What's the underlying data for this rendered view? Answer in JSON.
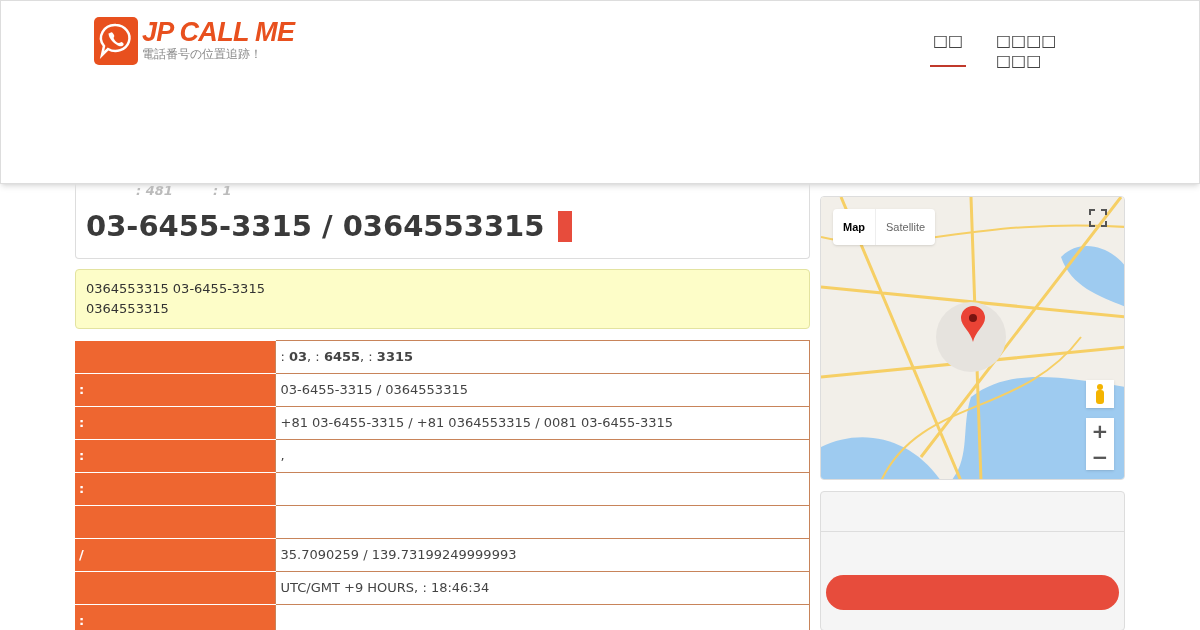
{
  "logo": {
    "title": "JP CALL ME",
    "tagline": "電話番号の位置追跡！"
  },
  "nav": [
    {
      "label": "□□",
      "selected": true
    },
    {
      "label": "□□□□ □□□",
      "selected": false
    }
  ],
  "stats": [
    ": 481",
    ": 1"
  ],
  "title": "03-6455-3315 / 0364553315",
  "notice": [
    "0364553315 03-6455-3315",
    "0364553315"
  ],
  "table": {
    "rows": [
      {
        "label": "",
        "value": ":  **03**, :  **6455**, :  **3315**"
      },
      {
        "label": ":",
        "value": "03-6455-3315 / 0364553315"
      },
      {
        "label": ":",
        "value": "+81 03-6455-3315 / +81 0364553315 / 0081 03-6455-3315"
      },
      {
        "label": ":",
        "value": ","
      },
      {
        "label": ":",
        "value": ""
      },
      {
        "label": "",
        "value": ""
      },
      {
        "label": "/",
        "value": "35.7090259 / 139.73199249999993"
      },
      {
        "label": "",
        "value": "UTC/GMT +9 HOURS, : 18:46:34"
      },
      {
        "label": ":",
        "value": ""
      }
    ]
  },
  "map": {
    "types": [
      {
        "label": "Map",
        "selected": true
      },
      {
        "label": "Satellite",
        "selected": false
      }
    ],
    "zoom": [
      "+",
      "−"
    ]
  }
}
